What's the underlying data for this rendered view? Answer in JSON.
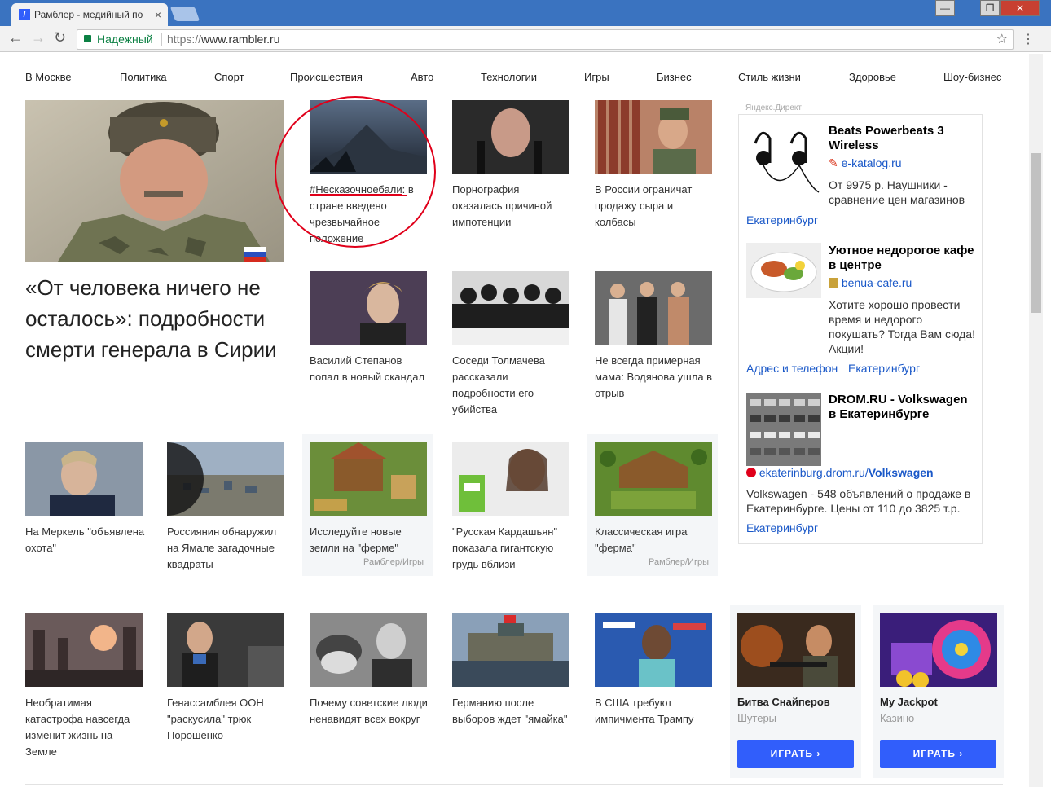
{
  "browser": {
    "tab_title": "Рамблер - медийный по",
    "tab_close": "×",
    "window_buttons": [
      "—",
      "❐",
      "✕"
    ],
    "secure_label": "Надежный",
    "url_scheme": "https://",
    "url_host": "www.rambler.ru",
    "icons": [
      "back-icon",
      "forward-icon",
      "reload-icon",
      "lock-icon",
      "star-icon",
      "menu-icon"
    ]
  },
  "nav": {
    "items": [
      "В Москве",
      "Политика",
      "Спорт",
      "Происшествия",
      "Авто",
      "Технологии",
      "Игры",
      "Бизнес",
      "Стиль жизни",
      "Здоровье",
      "Шоу-бизнес"
    ]
  },
  "lead": {
    "headline": "«От человека ничего не осталось»: подробности смерти генерала в Сирии"
  },
  "news": [
    {
      "id": "n1",
      "caption_hashtag": "#Несказочноебали",
      "caption_rest": ": в стране введено чрезвычайное положение"
    },
    {
      "id": "n2",
      "caption": "Порнография оказалась причиной импотенции"
    },
    {
      "id": "n3",
      "caption": "В России ограничат продажу сыра и колбасы"
    },
    {
      "id": "n4",
      "caption": "Василий Степанов попал в новый скандал"
    },
    {
      "id": "n5",
      "caption": "Соседи Толмачева рассказали подробности его убийства"
    },
    {
      "id": "n6",
      "caption": "Не всегда примерная мама: Водянова ушла в отрыв"
    },
    {
      "id": "n7",
      "caption": "На Меркель \"объявлена охота\""
    },
    {
      "id": "n8",
      "caption": "Россиянин обнаружил на Ямале загадочные квадраты"
    },
    {
      "id": "n9",
      "caption": "Исследуйте новые земли на \"ферме\"",
      "source": "Рамблер/Игры"
    },
    {
      "id": "n10",
      "caption": "\"Русская Кардашьян\" показала гигантскую грудь вблизи"
    },
    {
      "id": "n11",
      "caption": "Классическая игра \"ферма\"",
      "source": "Рамблер/Игры"
    },
    {
      "id": "n12",
      "caption": "Необратимая катастрофа навсегда изменит жизнь на Земле"
    },
    {
      "id": "n13",
      "caption": "Генассамблея ООН \"раскусила\" трюк Порошенко"
    },
    {
      "id": "n14",
      "caption": "Почему советские люди ненавидят всех вокруг"
    },
    {
      "id": "n15",
      "caption": "Германию после выборов ждет \"ямайка\""
    },
    {
      "id": "n16",
      "caption": "В США требуют импичмента Трампу"
    }
  ],
  "games": [
    {
      "title": "Битва Снайперов",
      "genre": "Шутеры",
      "button": "ИГРАТЬ ›"
    },
    {
      "title": "My Jackpot",
      "genre": "Казино",
      "button": "ИГРАТЬ ›"
    }
  ],
  "ads": {
    "label": "Яндекс.Директ",
    "items": [
      {
        "title": "Beats Powerbeats 3 Wireless",
        "domain": "e-katalog.ru",
        "text": "От 9975 р. Наушники - сравнение цен магазинов",
        "links": [
          "Екатеринбург"
        ]
      },
      {
        "title": "Уютное недорогое кафе в центре",
        "domain": "benua-cafe.ru",
        "text": "Хотите хорошо провести время и недорого покушать? Тогда Вам сюда! Акции!",
        "links": [
          "Адрес и телефон",
          "Екатеринбург"
        ]
      },
      {
        "title": "DROM.RU - Volkswagen в Екатеринбурге",
        "domain": "ekaterinburg.drom.ru/",
        "domain_bold": "Volkswagen",
        "text": "Volkswagen - 548 объявлений о продаже в Екатеринбурге. Цены от 110 до 3825 т.р.",
        "links": [
          "Екатеринбург"
        ]
      }
    ]
  },
  "colors": {
    "brand_blue": "#315efb",
    "link_blue": "#1a58c8",
    "annotation_red": "#e0001a",
    "secure_green": "#0b8043"
  }
}
